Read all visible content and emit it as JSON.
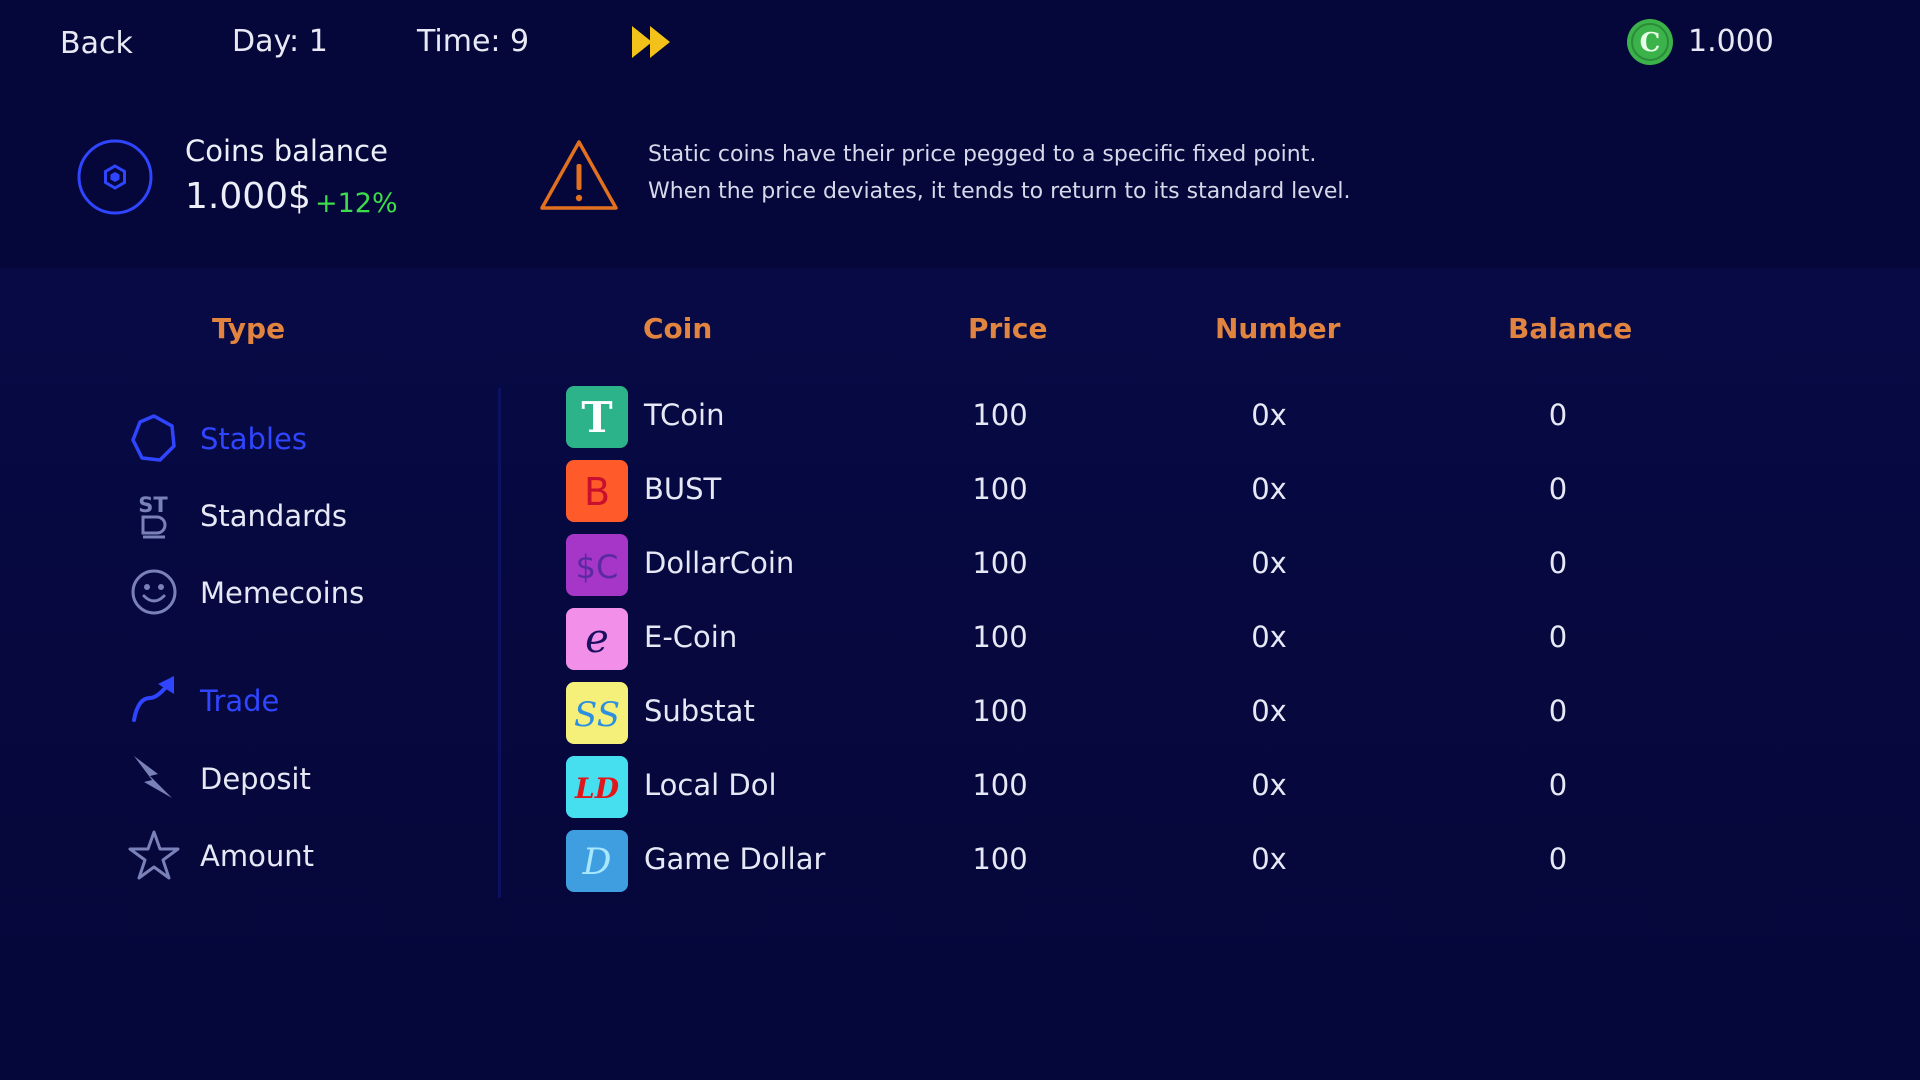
{
  "topbar": {
    "back_label": "Back",
    "day_label": "Day: 1",
    "time_label": "Time: 9",
    "credits_value": "1.000",
    "fast_forward_color": "#f2c21b",
    "credit_color": "#3cb24b"
  },
  "summary": {
    "balance_title": "Coins balance",
    "balance_amount": "1.000$",
    "balance_change": "+12%",
    "change_color": "#3ddc4a",
    "accent_color": "#2f45ff"
  },
  "notice": {
    "line1": "Static coins have their price pegged to a specific fixed point.",
    "line2": "When the price deviates, it tends to return to its standard level.",
    "warning_color": "#e2701f"
  },
  "columns": {
    "type": "Type",
    "coin": "Coin",
    "price": "Price",
    "number": "Number",
    "balance": "Balance"
  },
  "sidebar": {
    "types": [
      {
        "label": "Stables",
        "icon": "hexagon-icon",
        "active": true
      },
      {
        "label": "Standards",
        "icon": "st-icon",
        "active": false
      },
      {
        "label": "Memecoins",
        "icon": "smiley-icon",
        "active": false
      }
    ],
    "actions": [
      {
        "label": "Trade",
        "icon": "trend-arrow-icon",
        "active": true
      },
      {
        "label": "Deposit",
        "icon": "lightning-icon",
        "active": false
      },
      {
        "label": "Amount",
        "icon": "star-icon",
        "active": false
      }
    ]
  },
  "coins": [
    {
      "name": "TCoin",
      "logo_text": "T",
      "logo_bg": "#2db38a",
      "logo_fg": "#ffffff",
      "price": "100",
      "number": "0x",
      "balance": "0"
    },
    {
      "name": "BUST",
      "logo_text": "B",
      "logo_bg": "#ff5a2a",
      "logo_fg": "#c8102e",
      "price": "100",
      "number": "0x",
      "balance": "0"
    },
    {
      "name": "DollarCoin",
      "logo_text": "$C",
      "logo_bg": "#a536c7",
      "logo_fg": "#5b2aa0",
      "price": "100",
      "number": "0x",
      "balance": "0"
    },
    {
      "name": "E-Coin",
      "logo_text": "e",
      "logo_bg": "#f28fe8",
      "logo_fg": "#1a1060",
      "price": "100",
      "number": "0x",
      "balance": "0"
    },
    {
      "name": "Substat",
      "logo_text": "SS",
      "logo_bg": "#f4f07a",
      "logo_fg": "#2d8fe0",
      "price": "100",
      "number": "0x",
      "balance": "0"
    },
    {
      "name": "Local Dol",
      "logo_text": "LD",
      "logo_bg": "#46dff0",
      "logo_fg": "#e0161b",
      "price": "100",
      "number": "0x",
      "balance": "0"
    },
    {
      "name": "Game Dollar",
      "logo_text": "D",
      "logo_bg": "#3f9ee0",
      "logo_fg": "#a8e8ff",
      "price": "100",
      "number": "0x",
      "balance": "0"
    }
  ]
}
